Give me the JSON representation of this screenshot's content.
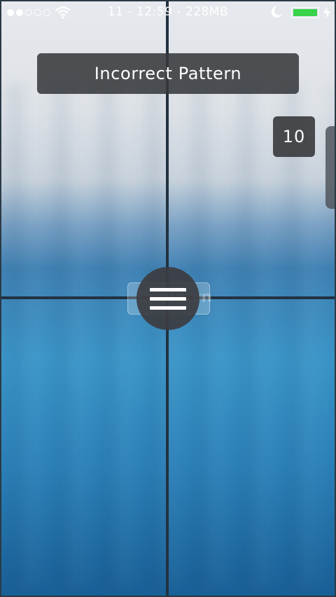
{
  "statusbar": {
    "signal_dots": {
      "filled": 2,
      "total": 5
    },
    "center_text": "11 - 12:59 - 228MB",
    "battery_level": 1.0,
    "battery_color": "#37d44a"
  },
  "lockscreen": {
    "banner_text": "Incorrect Pattern",
    "counter_value": "10",
    "menu_icon": "hamburger-menu-icon"
  },
  "watermark": {
    "text": "Cydia.vn"
  }
}
